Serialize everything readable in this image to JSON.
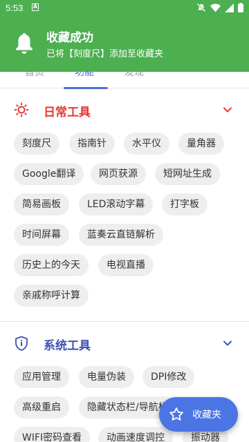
{
  "status_bar": {
    "time": "5:53",
    "notif_letter": "A"
  },
  "toast": {
    "title": "收藏成功",
    "message": "已将【刻度尺】添加至收藏夹",
    "color": "#4caf50"
  },
  "tabs": [
    {
      "label": "首页"
    },
    {
      "label": "功能"
    },
    {
      "label": "发现"
    }
  ],
  "accent": "#4b6fd6",
  "sections": [
    {
      "title": "日常工具",
      "title_color": "#e53935",
      "icon": "sun-icon",
      "chips": [
        "刻度尺",
        "指南针",
        "水平仪",
        "量角器",
        "Google翻译",
        "网页获源",
        "短网址生成",
        "简易画板",
        "LED滚动字幕",
        "打字板",
        "时间屏幕",
        "蓝奏云直链解析",
        "历史上的今天",
        "电视直播",
        "亲戚称呼计算"
      ]
    },
    {
      "title": "系统工具",
      "title_color": "#3f51b5",
      "icon": "shield-icon",
      "chips": [
        "应用管理",
        "电量伪装",
        "DPI修改",
        "高级重启",
        "隐藏状态栏/导航栏",
        "WIFI密码查看",
        "动画速度调控",
        "振动器"
      ]
    }
  ],
  "fab": {
    "label": "收藏夹",
    "icon": "star-icon"
  }
}
